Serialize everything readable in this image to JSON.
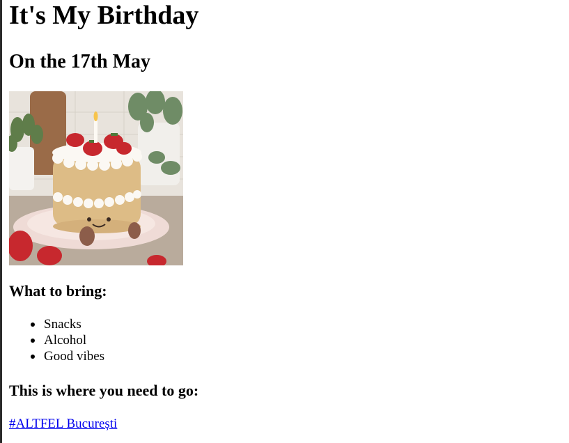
{
  "title": "It's My Birthday",
  "date_heading": "On the 17th May",
  "image": {
    "icon": "birthday-cake-photo"
  },
  "bring": {
    "heading": "What to bring:",
    "items": [
      "Snacks",
      "Alcohol",
      "Good vibes"
    ]
  },
  "location": {
    "heading": "This is where you need to go:",
    "link_text": "#ALTFEL București"
  },
  "colors": {
    "link": "#0000ee",
    "text": "#000000",
    "background": "#ffffff"
  }
}
